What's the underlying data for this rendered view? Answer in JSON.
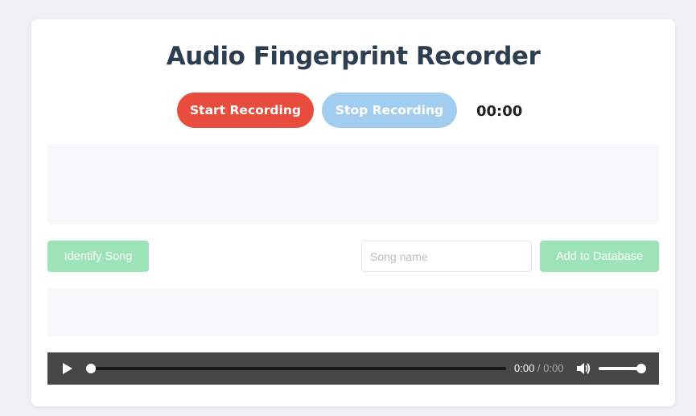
{
  "app": {
    "title": "Audio Fingerprint Recorder"
  },
  "controls": {
    "start_label": "Start Recording",
    "stop_label": "Stop Recording",
    "timer": "00:00"
  },
  "actions": {
    "identify_label": "Identify Song",
    "song_name_value": "",
    "song_name_placeholder": "Song name",
    "add_label": "Add to Database"
  },
  "player": {
    "current_time": "0:00",
    "separator": " / ",
    "total_time": "0:00",
    "progress": 0,
    "volume": 1.0,
    "icons": {
      "play": "play-icon",
      "volume": "volume-icon"
    }
  },
  "colors": {
    "start_button": "#e74c3c",
    "stop_button": "#a3cdee",
    "green_buttons": "#9de3b8",
    "title": "#2c3e50",
    "player_bg": "#474747"
  }
}
